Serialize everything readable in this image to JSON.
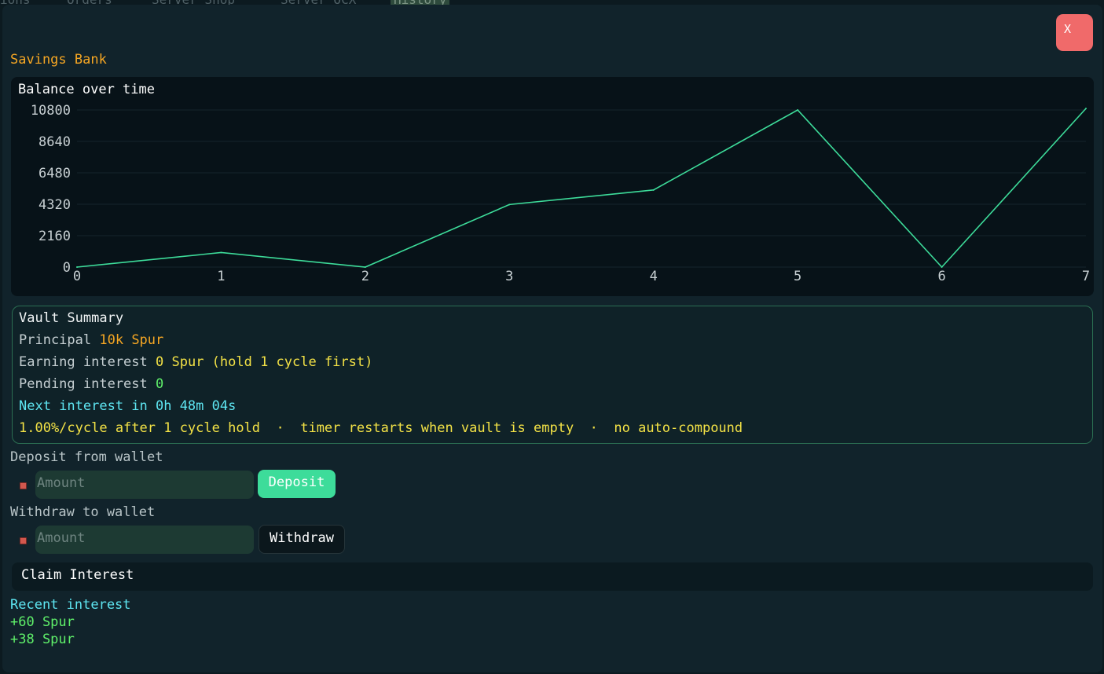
{
  "background_tabs": [
    "ions",
    "Orders",
    "Server Shop",
    "Server OCX",
    "History"
  ],
  "window": {
    "title": "Savings Bank",
    "close_label": "X"
  },
  "chart": {
    "title": "Balance over time"
  },
  "chart_data": {
    "type": "line",
    "x": [
      0,
      1,
      2,
      3,
      4,
      5,
      6,
      7
    ],
    "y": [
      0,
      1000,
      0,
      4300,
      5300,
      10800,
      0,
      10900
    ],
    "xticks": [
      "0",
      "1",
      "2",
      "3",
      "4",
      "5",
      "6",
      "7"
    ],
    "yticks": [
      "0",
      "2160",
      "4320",
      "6480",
      "8640",
      "10800"
    ],
    "xlim": [
      0,
      7
    ],
    "ylim": [
      0,
      10800
    ],
    "grid": true,
    "line_color": "#3ddc9a"
  },
  "vault": {
    "title": "Vault Summary",
    "principal_label": "Principal",
    "principal_value": "10k Spur",
    "earning_label": "Earning interest",
    "earning_value": "0 Spur (hold 1 cycle first)",
    "pending_label": "Pending interest",
    "pending_value": "0",
    "next_interest": "Next interest in 0h 48m 04s",
    "rate_note": "1.00%/cycle after 1 cycle hold  ·  timer restarts when vault is empty  ·  no auto-compound"
  },
  "deposit": {
    "label": "Deposit from wallet",
    "placeholder": "Amount",
    "button": "Deposit"
  },
  "withdraw": {
    "label": "Withdraw to wallet",
    "placeholder": "Amount",
    "button": "Withdraw"
  },
  "claim": {
    "button": "Claim Interest"
  },
  "recent": {
    "title": "Recent interest",
    "items": [
      "+60 Spur",
      "+38 Spur"
    ]
  },
  "colors": {
    "accent_orange": "#f5a623",
    "accent_green": "#3ddc9a",
    "close_red": "#f06a6a",
    "cyan": "#5ee6f2",
    "yellow": "#f3e246"
  }
}
